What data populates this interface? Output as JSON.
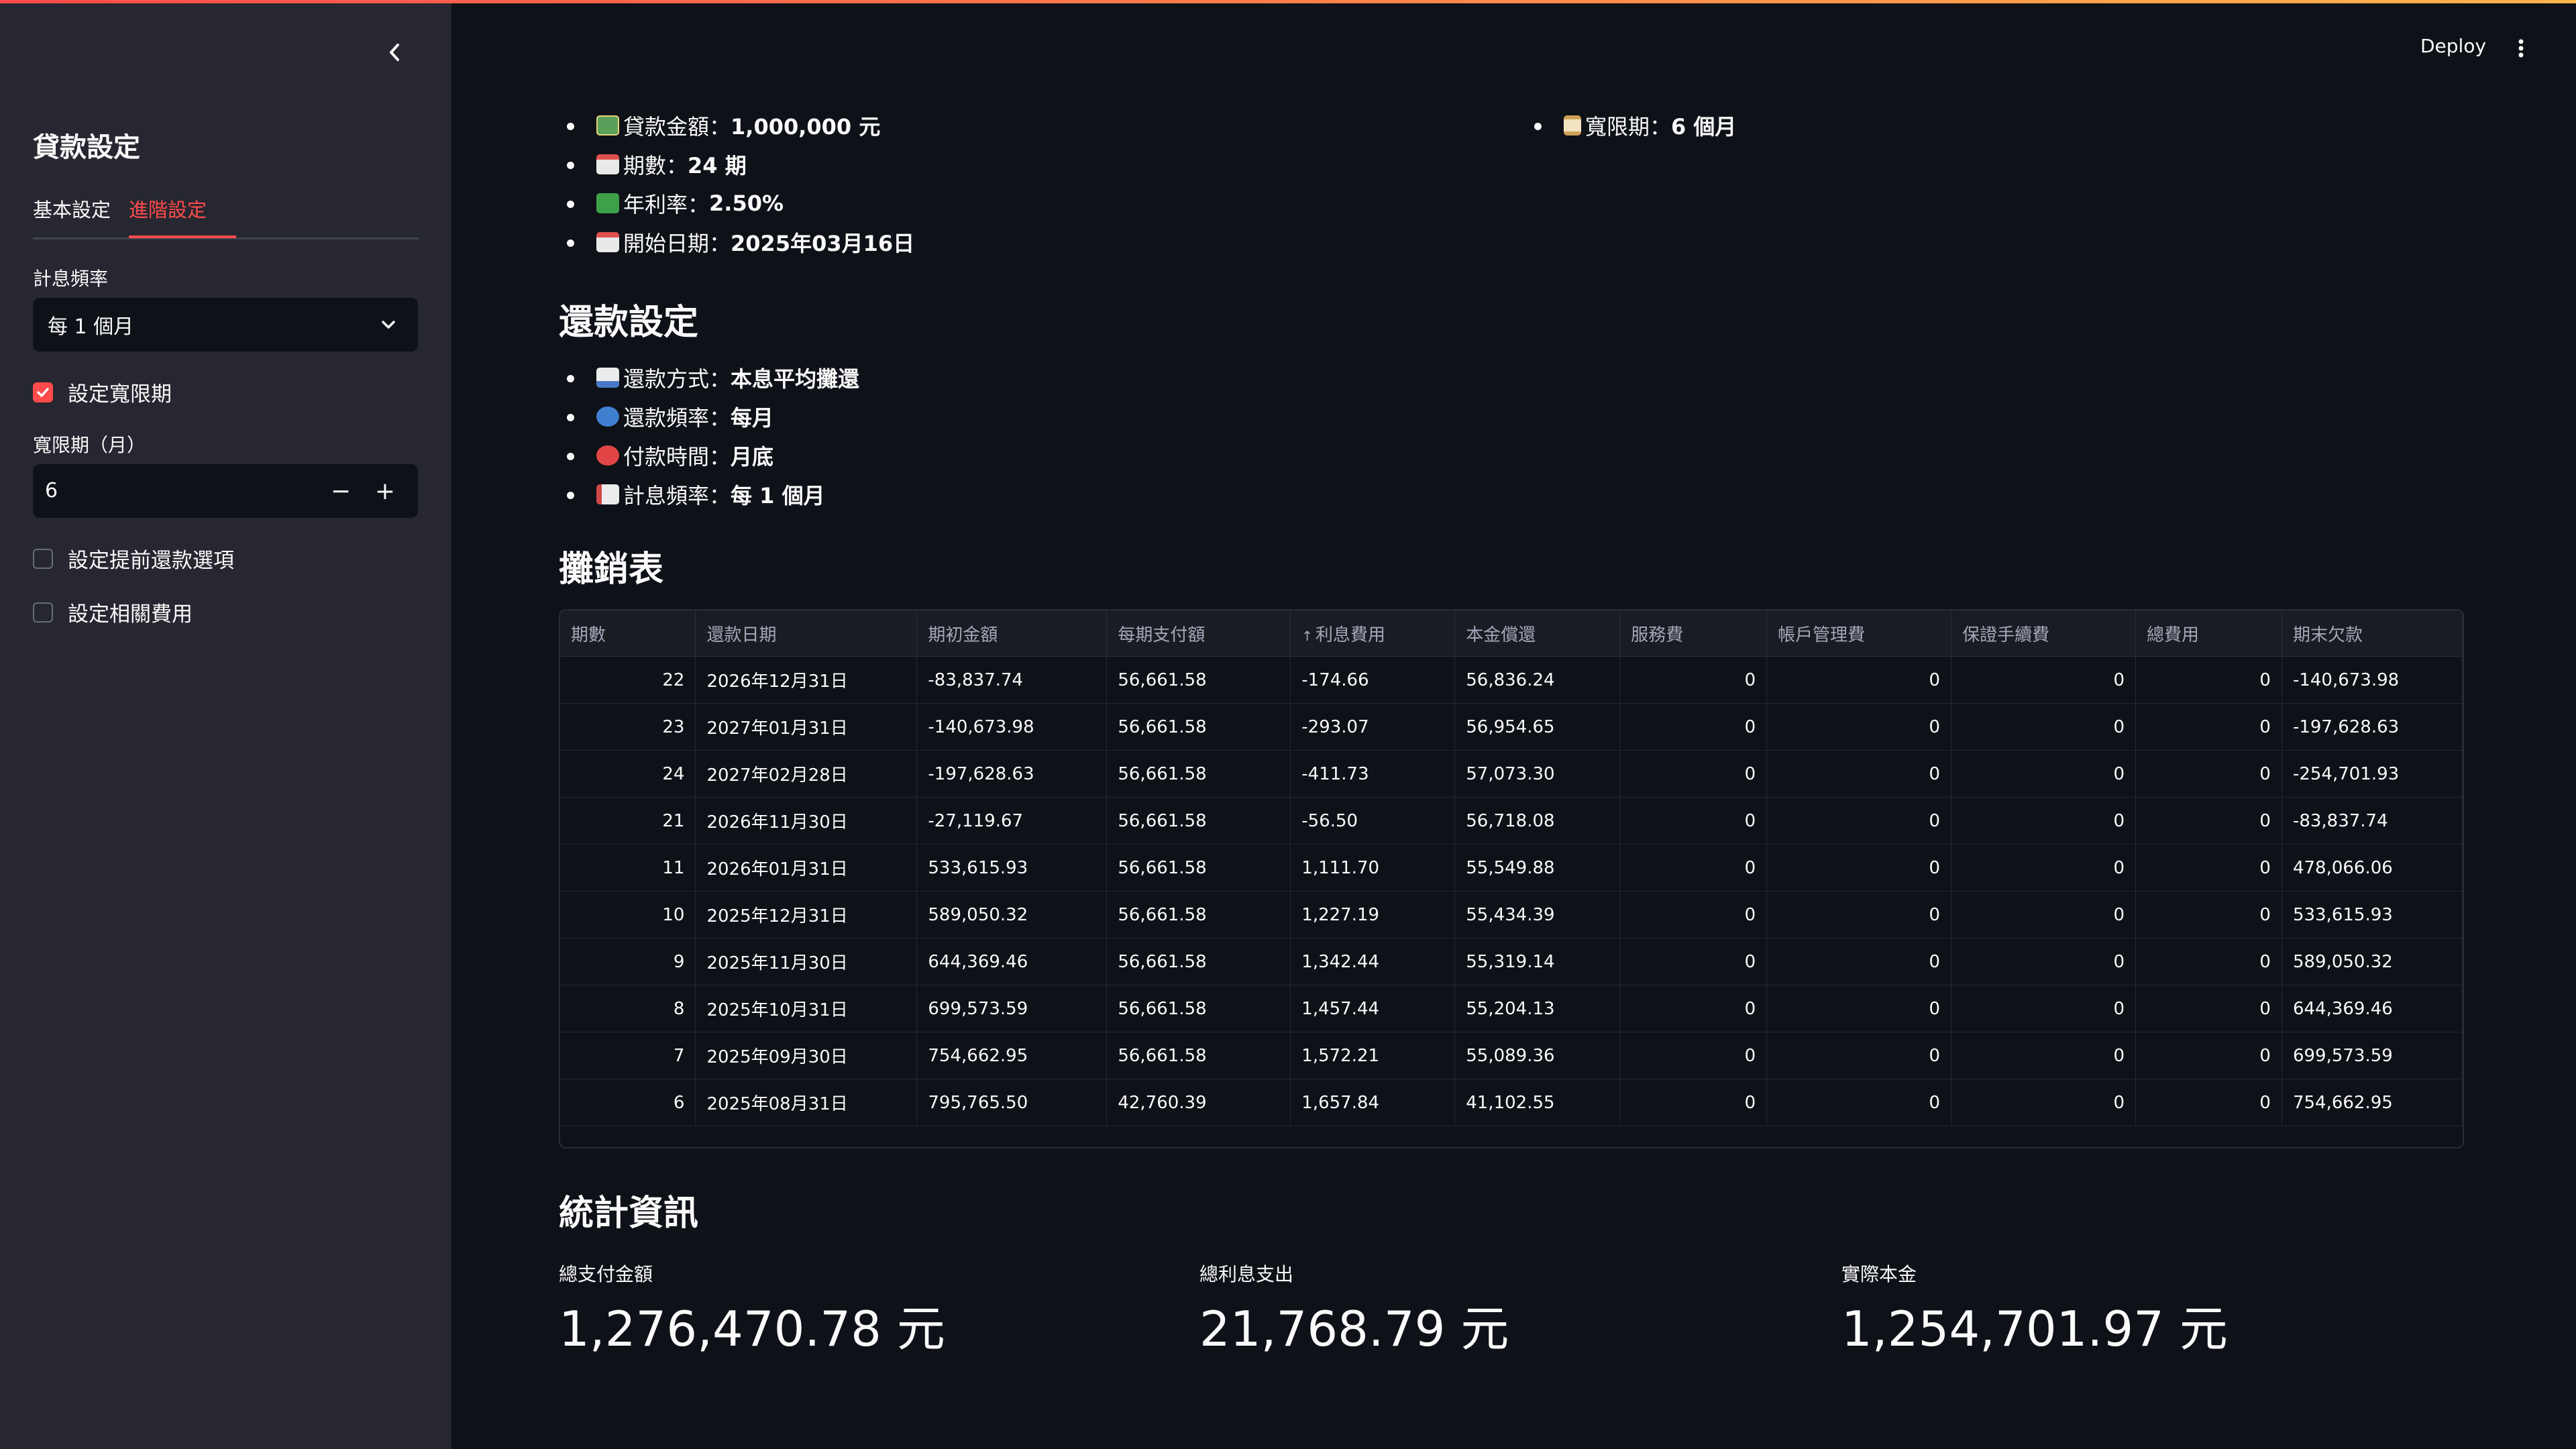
{
  "sidebar": {
    "title": "貸款設定",
    "tabs": [
      "基本設定",
      "進階設定"
    ],
    "active_tab": "進階設定",
    "freq_label": "計息頻率",
    "freq_value": "每 1 個月",
    "grace_checkbox": "設定寬限期",
    "grace_checked": true,
    "grace_label": "寬限期（月）",
    "grace_value": "6",
    "prepay_checkbox": "設定提前還款選項",
    "fees_checkbox": "設定相關費用"
  },
  "header": {
    "deploy": "Deploy"
  },
  "loan_info": [
    {
      "icon": "money-icon",
      "label": "貸款金額：",
      "value": "1,000,000 元"
    },
    {
      "icon": "calendar-icon",
      "label": "期數：",
      "value": "24 期"
    },
    {
      "icon": "chart-up-icon",
      "label": "年利率：",
      "value": "2.50%"
    },
    {
      "icon": "calendar-date-icon",
      "label": "開始日期：",
      "value": "2025年03月16日"
    }
  ],
  "grace_info": {
    "icon": "hourglass-icon",
    "label": "寬限期：",
    "value": "6 個月"
  },
  "repayment": {
    "title": "還款設定",
    "items": [
      {
        "icon": "bar-chart-icon",
        "label": "還款方式：",
        "value": "本息平均攤還"
      },
      {
        "icon": "repeat-icon",
        "label": "還款頻率：",
        "value": "每月"
      },
      {
        "icon": "alarm-clock-icon",
        "label": "付款時間：",
        "value": "月底"
      },
      {
        "icon": "trend-chart-icon",
        "label": "計息頻率：",
        "value": "每 1 個月"
      }
    ]
  },
  "amortization": {
    "title": "攤銷表",
    "sort_indicator": "↑",
    "columns": [
      "期數",
      "還款日期",
      "期初金額",
      "每期支付額",
      "利息費用",
      "本金償還",
      "服務費",
      "帳戶管理費",
      "保證手續費",
      "總費用",
      "期末欠款"
    ],
    "rows": [
      [
        "22",
        "2026年12月31日",
        "-83,837.74",
        "56,661.58",
        "-174.66",
        "56,836.24",
        "0",
        "0",
        "0",
        "0",
        "-140,673.98"
      ],
      [
        "23",
        "2027年01月31日",
        "-140,673.98",
        "56,661.58",
        "-293.07",
        "56,954.65",
        "0",
        "0",
        "0",
        "0",
        "-197,628.63"
      ],
      [
        "24",
        "2027年02月28日",
        "-197,628.63",
        "56,661.58",
        "-411.73",
        "57,073.30",
        "0",
        "0",
        "0",
        "0",
        "-254,701.93"
      ],
      [
        "21",
        "2026年11月30日",
        "-27,119.67",
        "56,661.58",
        "-56.50",
        "56,718.08",
        "0",
        "0",
        "0",
        "0",
        "-83,837.74"
      ],
      [
        "11",
        "2026年01月31日",
        "533,615.93",
        "56,661.58",
        "1,111.70",
        "55,549.88",
        "0",
        "0",
        "0",
        "0",
        "478,066.06"
      ],
      [
        "10",
        "2025年12月31日",
        "589,050.32",
        "56,661.58",
        "1,227.19",
        "55,434.39",
        "0",
        "0",
        "0",
        "0",
        "533,615.93"
      ],
      [
        "9",
        "2025年11月30日",
        "644,369.46",
        "56,661.58",
        "1,342.44",
        "55,319.14",
        "0",
        "0",
        "0",
        "0",
        "589,050.32"
      ],
      [
        "8",
        "2025年10月31日",
        "699,573.59",
        "56,661.58",
        "1,457.44",
        "55,204.13",
        "0",
        "0",
        "0",
        "0",
        "644,369.46"
      ],
      [
        "7",
        "2025年09月30日",
        "754,662.95",
        "56,661.58",
        "1,572.21",
        "55,089.36",
        "0",
        "0",
        "0",
        "0",
        "699,573.59"
      ],
      [
        "6",
        "2025年08月31日",
        "795,765.50",
        "42,760.39",
        "1,657.84",
        "41,102.55",
        "0",
        "0",
        "0",
        "0",
        "754,662.95"
      ]
    ]
  },
  "stats": {
    "title": "統計資訊",
    "metrics": [
      {
        "label": "總支付金額",
        "value": "1,276,470.78 元"
      },
      {
        "label": "總利息支出",
        "value": "21,768.79 元"
      },
      {
        "label": "實際本金",
        "value": "1,254,701.97 元"
      }
    ]
  },
  "colors": {
    "accent": "#ff4b4b",
    "sidebar_bg": "#262730",
    "main_bg": "#0e1117"
  }
}
